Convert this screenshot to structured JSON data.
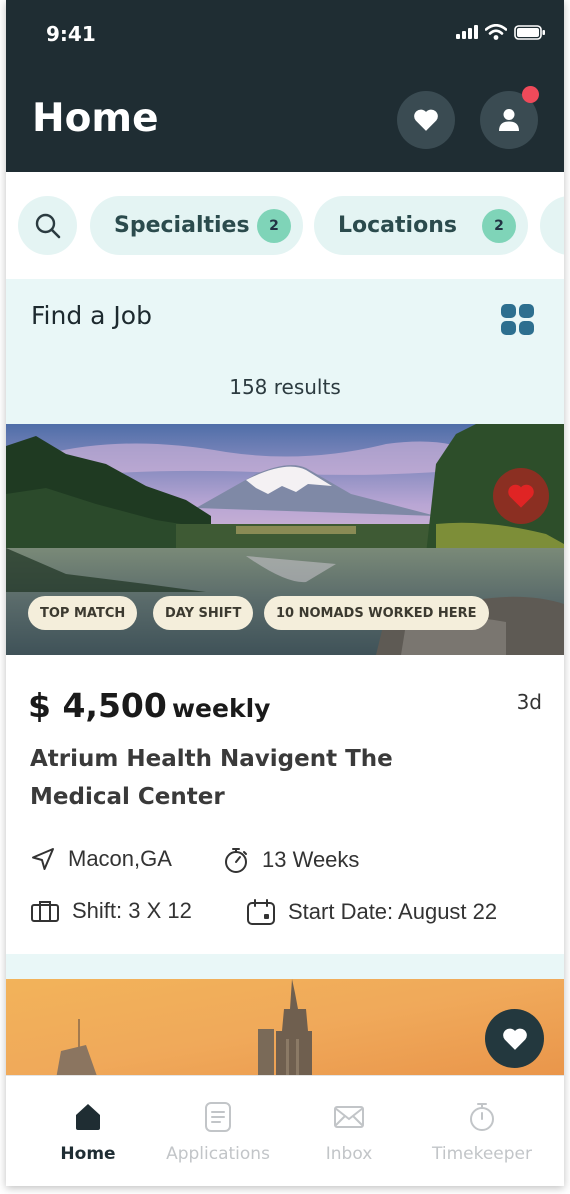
{
  "status_bar": {
    "time": "9:41"
  },
  "header": {
    "title": "Home"
  },
  "filters": {
    "specialties": {
      "label": "Specialties",
      "count": "2"
    },
    "locations": {
      "label": "Locations",
      "count": "2"
    }
  },
  "find_job": {
    "title": "Find a Job",
    "results": "158 results"
  },
  "job_card": {
    "tags": [
      "TOP MATCH",
      "DAY SHIFT",
      "10 NOMADS WORKED HERE"
    ],
    "salary_amount": "$ 4,500",
    "salary_period": "weekly",
    "posted": "3d",
    "facility": "Atrium Health Navigent The Medical Center",
    "location": "Macon,GA",
    "duration": "13 Weeks",
    "shift": "Shift: 3 X 12",
    "start_date": "Start Date: August 22",
    "favorited": true
  },
  "tabbar": {
    "items": [
      {
        "label": "Home",
        "icon": "home-icon",
        "active": true
      },
      {
        "label": "Applications",
        "icon": "document-icon",
        "active": false
      },
      {
        "label": "Inbox",
        "icon": "mail-icon",
        "active": false
      },
      {
        "label": "Timekeeper",
        "icon": "stopwatch-icon",
        "active": false
      }
    ]
  },
  "colors": {
    "header_bg": "#1f2d33",
    "chip_bg": "#e4f4f3",
    "badge": "#7fd4b8",
    "section_bg": "#e9f7f7",
    "notification": "#ef4a5a",
    "favorite": "#e02424"
  }
}
